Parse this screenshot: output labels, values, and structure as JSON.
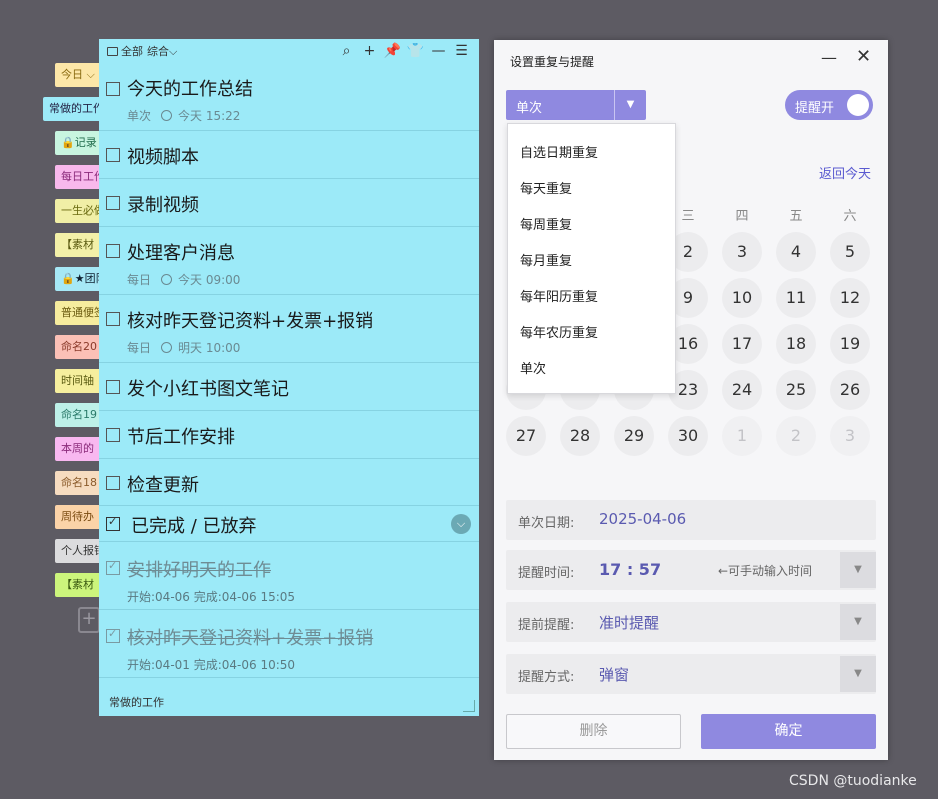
{
  "side_tabs": [
    {
      "label": "今日",
      "color": "#fde7a8",
      "text_color": "#8a6a10"
    },
    {
      "label": "常做的工作",
      "color": "#9ceaf8",
      "text_color": "#224"
    },
    {
      "label": "记录",
      "color": "#c8f5e0",
      "text_color": "#1f6a4a"
    },
    {
      "label": "每日工作",
      "color": "#f8b8ec",
      "text_color": "#8a2a7a"
    },
    {
      "label": "一生必做",
      "color": "#f1efa6",
      "text_color": "#6a6a10"
    },
    {
      "label": "【素材",
      "color": "#f3f0a8",
      "text_color": "#5a5a10"
    },
    {
      "label": "★团队",
      "color": "#a6e8f6",
      "text_color": "#123"
    },
    {
      "label": "普通便签",
      "color": "#f6ec9e",
      "text_color": "#6a5a10"
    },
    {
      "label": "命名20",
      "color": "#fbc0b6",
      "text_color": "#8a3a2a"
    },
    {
      "label": "时间轴",
      "color": "#f6ef9e",
      "text_color": "#5a5a10"
    },
    {
      "label": "命名19",
      "color": "#bdf0e8",
      "text_color": "#2a7a6a"
    },
    {
      "label": "本周的",
      "color": "#f8b8f0",
      "text_color": "#8a2a7a"
    },
    {
      "label": "命名18",
      "color": "#f6dcc0",
      "text_color": "#8a5a2a"
    },
    {
      "label": "周待办",
      "color": "#fbd3a8",
      "text_color": "#7a4a10"
    },
    {
      "label": "个人报销",
      "color": "#dcdcde",
      "text_color": "#333"
    },
    {
      "label": "【素材",
      "color": "#ccf57c",
      "text_color": "#3a5a10"
    }
  ],
  "todo": {
    "header_left": "全部",
    "header_filter": "综合",
    "items": [
      {
        "title": "今天的工作总结",
        "repeat": "单次",
        "time": "今天 15:22"
      },
      {
        "title": "视频脚本"
      },
      {
        "title": "录制视频"
      },
      {
        "title": "处理客户消息",
        "repeat": "每日",
        "time": "今天 09:00"
      },
      {
        "title": "核对昨天登记资料+发票+报销",
        "repeat": "每日",
        "time": "明天 10:00"
      },
      {
        "title": "发个小红书图文笔记"
      },
      {
        "title": "节后工作安排"
      },
      {
        "title": "检查更新"
      }
    ],
    "done_section": "已完成 / 已放弃",
    "done_items": [
      {
        "title": "安排好明天的工作",
        "meta": "开始:04-06  完成:04-06 15:05"
      },
      {
        "title": "核对昨天登记资料+发票+报销",
        "meta": "开始:04-01  完成:04-06 10:50"
      }
    ],
    "footer": "常做的工作"
  },
  "dialog": {
    "title": "设置重复与提醒",
    "repeat_value": "单次",
    "reminder_toggle": "提醒开",
    "back_today": "返回今天",
    "weekdays": [
      "三",
      "四",
      "五",
      "六"
    ],
    "calendar_rows": [
      [
        "2",
        "3",
        "4",
        "5"
      ],
      [
        "9",
        "10",
        "11",
        "12"
      ],
      [
        "16",
        "17",
        "18",
        "19"
      ],
      [
        "23",
        "24",
        "25",
        "26"
      ]
    ],
    "last_row": [
      "27",
      "28",
      "29",
      "30",
      "1",
      "2",
      "3"
    ],
    "fields": {
      "date_label": "单次日期:",
      "date_value": "2025-04-06",
      "time_label": "提醒时间:",
      "time_value": "17 : 57",
      "time_hint": "←可手动输入时间",
      "advance_label": "提前提醒:",
      "advance_value": "准时提醒",
      "method_label": "提醒方式:",
      "method_value": "弹窗"
    },
    "delete_button": "删除",
    "ok_button": "确定"
  },
  "repeat_menu": [
    "自选日期重复",
    "每天重复",
    "每周重复",
    "每月重复",
    "每年阳历重复",
    "每年农历重复",
    "单次"
  ],
  "watermark": "CSDN @tuodianke",
  "colors": {
    "accent": "#8f89e0",
    "todo_bg": "#9ceaf8",
    "dialog_bg": "#f6f6f8"
  }
}
